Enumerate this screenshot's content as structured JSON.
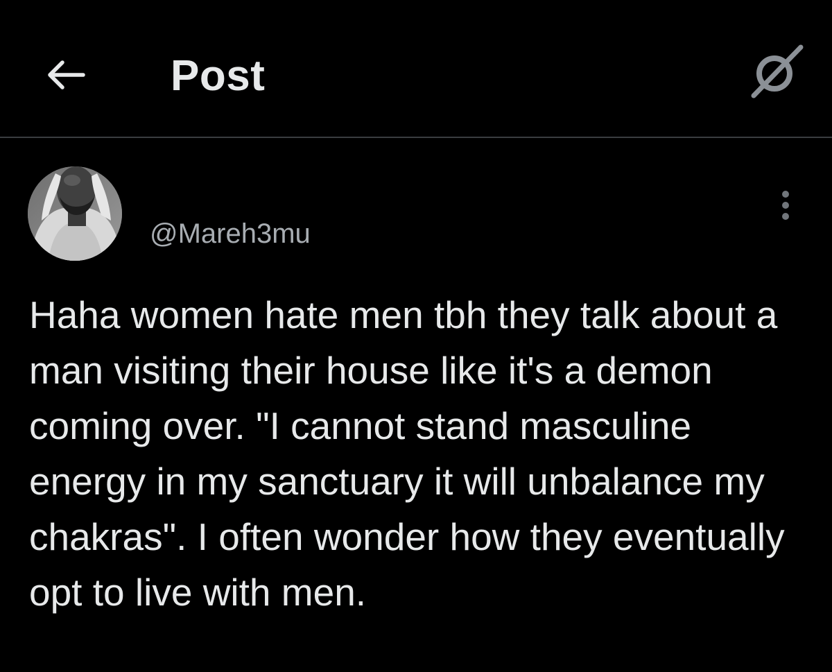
{
  "header": {
    "title": "Post",
    "back_icon": "back-arrow-icon",
    "right_icon": "grok-icon"
  },
  "post": {
    "handle": "@Mareh3mu",
    "avatar_icon": "user-avatar",
    "more_icon": "more-vertical-icon",
    "text": "Haha women hate men tbh they talk about a man visiting their house like it's a demon coming over. \"I cannot stand masculine energy in my sanctuary it will unbalance my chakras\". I often wonder how they eventually opt to live with men."
  },
  "colors": {
    "background": "#000000",
    "text_primary": "#e7e9ea",
    "text_secondary": "#a8adb2",
    "divider": "#3a3d40"
  }
}
